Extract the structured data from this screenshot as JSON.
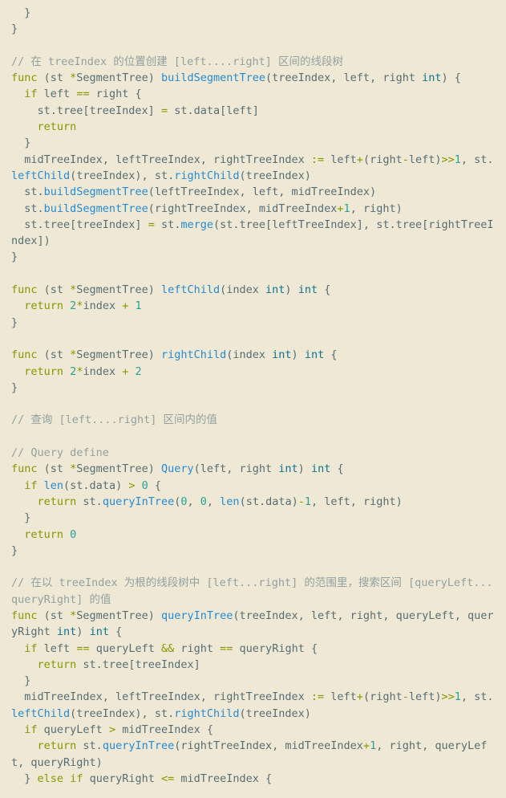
{
  "code": {
    "l1": "  }",
    "l2": "}",
    "l3": "",
    "c1": "// 在 treeIndex 的位置创建 [left....right] 区间的线段树",
    "f1_func": "func",
    "f1_recv": " (st ",
    "f1_star": "*",
    "f1_type": "SegmentTree) ",
    "f1_name": "buildSegmentTree",
    "f1_sig1": "(treeIndex, left, right ",
    "f1_int": "int",
    "f1_sig2": ") {",
    "f1_b1_if": "  if",
    "f1_b1_a": " left ",
    "f1_b1_eq": "==",
    "f1_b1_b": " right {",
    "f1_b2_a": "    st.tree[treeIndex] ",
    "f1_b2_eq": "=",
    "f1_b2_b": " st.data[left]",
    "f1_b3": "    return",
    "f1_b4": "  }",
    "f1_b5_a": "  midTreeIndex, leftTreeIndex, rightTreeIndex ",
    "f1_b5_op": ":=",
    "f1_b5_b": " left",
    "f1_b5_plus": "+",
    "f1_b5_c": "(right",
    "f1_b5_minus": "-",
    "f1_b5_d": "left)",
    "f1_b5_sh": ">>",
    "f1_b5_one": "1",
    "f1_b5_e": ", st.",
    "f1_b5_lc": "leftChild",
    "f1_b5_f": "(treeIndex), st.",
    "f1_b5_rc": "rightChild",
    "f1_b5_g": "(treeIndex)",
    "f1_b6_a": "  st.",
    "f1_b6_fn": "buildSegmentTree",
    "f1_b6_b": "(leftTreeIndex, left, midTreeIndex)",
    "f1_b7_a": "  st.",
    "f1_b7_fn": "buildSegmentTree",
    "f1_b7_b": "(rightTreeIndex, midTreeIndex",
    "f1_b7_plus": "+",
    "f1_b7_one": "1",
    "f1_b7_c": ", right)",
    "f1_b8_a": "  st.tree[treeIndex] ",
    "f1_b8_eq": "=",
    "f1_b8_b": " st.",
    "f1_b8_fn": "merge",
    "f1_b8_c": "(st.tree[leftTreeIndex], st.tree[rightTreeIndex])",
    "f1_close": "}",
    "f2_func": "func",
    "f2_recv": " (st ",
    "f2_star": "*",
    "f2_type": "SegmentTree) ",
    "f2_name": "leftChild",
    "f2_sig1": "(index ",
    "f2_int": "int",
    "f2_sig2": ") ",
    "f2_ret": "int",
    "f2_sig3": " {",
    "f2_b1_ret": "  return ",
    "f2_b1_two": "2",
    "f2_b1_mul": "*",
    "f2_b1_a": "index ",
    "f2_b1_plus": "+",
    "f2_b1_one": " 1",
    "f2_close": "}",
    "f3_func": "func",
    "f3_recv": " (st ",
    "f3_star": "*",
    "f3_type": "SegmentTree) ",
    "f3_name": "rightChild",
    "f3_sig1": "(index ",
    "f3_int": "int",
    "f3_sig2": ") ",
    "f3_ret": "int",
    "f3_sig3": " {",
    "f3_b1_ret": "  return ",
    "f3_b1_two": "2",
    "f3_b1_mul": "*",
    "f3_b1_a": "index ",
    "f3_b1_plus": "+",
    "f3_b1_two2": " 2",
    "f3_close": "}",
    "c2": "// 查询 [left....right] 区间内的值",
    "c3": "// Query define",
    "f4_func": "func",
    "f4_recv": " (st ",
    "f4_star": "*",
    "f4_type": "SegmentTree) ",
    "f4_name": "Query",
    "f4_sig1": "(left, right ",
    "f4_int": "int",
    "f4_sig2": ") ",
    "f4_ret": "int",
    "f4_sig3": " {",
    "f4_b1_if": "  if ",
    "f4_b1_len": "len",
    "f4_b1_a": "(st.data) ",
    "f4_b1_gt": ">",
    "f4_b1_sp": " ",
    "f4_b1_zero": "0",
    "f4_b1_b": " {",
    "f4_b2_ret": "    return",
    "f4_b2_a": " st.",
    "f4_b2_fn": "queryInTree",
    "f4_b2_b": "(",
    "f4_b2_z1": "0",
    "f4_b2_c": ", ",
    "f4_b2_z2": "0",
    "f4_b2_d": ", ",
    "f4_b2_len": "len",
    "f4_b2_e": "(st.data)",
    "f4_b2_minus": "-",
    "f4_b2_one": "1",
    "f4_b2_f": ", left, right)",
    "f4_b3": "  }",
    "f4_b4_ret": "  return ",
    "f4_b4_zero": "0",
    "f4_close": "}",
    "c4": "// 在以 treeIndex 为根的线段树中 [left...right] 的范围里，搜索区间 [queryLeft...queryRight] 的值",
    "f5_func": "func",
    "f5_recv": " (st ",
    "f5_star": "*",
    "f5_type": "SegmentTree) ",
    "f5_name": "queryInTree",
    "f5_sig1": "(treeIndex, left, right, queryLeft, queryRight ",
    "f5_int": "int",
    "f5_sig2": ") ",
    "f5_ret": "int",
    "f5_sig3": " {",
    "f5_b1_if": "  if",
    "f5_b1_a": " left ",
    "f5_b1_eq1": "==",
    "f5_b1_b": " queryLeft ",
    "f5_b1_and": "&&",
    "f5_b1_c": " right ",
    "f5_b1_eq2": "==",
    "f5_b1_d": " queryRight {",
    "f5_b2_ret": "    return",
    "f5_b2_a": " st.tree[treeIndex]",
    "f5_b3": "  }",
    "f5_b4_a": "  midTreeIndex, leftTreeIndex, rightTreeIndex ",
    "f5_b4_op": ":=",
    "f5_b4_b": " left",
    "f5_b4_plus": "+",
    "f5_b4_c": "(right",
    "f5_b4_minus": "-",
    "f5_b4_d": "left)",
    "f5_b4_sh": ">>",
    "f5_b4_one": "1",
    "f5_b4_e": ", st.",
    "f5_b4_lc": "leftChild",
    "f5_b4_f": "(treeIndex), st.",
    "f5_b4_rc": "rightChild",
    "f5_b4_g": "(treeIndex)",
    "f5_b5_if": "  if",
    "f5_b5_a": " queryLeft ",
    "f5_b5_gt": ">",
    "f5_b5_b": " midTreeIndex {",
    "f5_b6_ret": "    return",
    "f5_b6_a": " st.",
    "f5_b6_fn": "queryInTree",
    "f5_b6_b": "(rightTreeIndex, midTreeIndex",
    "f5_b6_plus": "+",
    "f5_b6_one": "1",
    "f5_b6_c": ", right, queryLeft, queryRight)",
    "f5_b7_a": "  } ",
    "f5_b7_else": "else",
    "f5_b7_b": " ",
    "f5_b7_if": "if",
    "f5_b7_c": " queryRight ",
    "f5_b7_le": "<=",
    "f5_b7_d": " midTreeIndex {"
  }
}
